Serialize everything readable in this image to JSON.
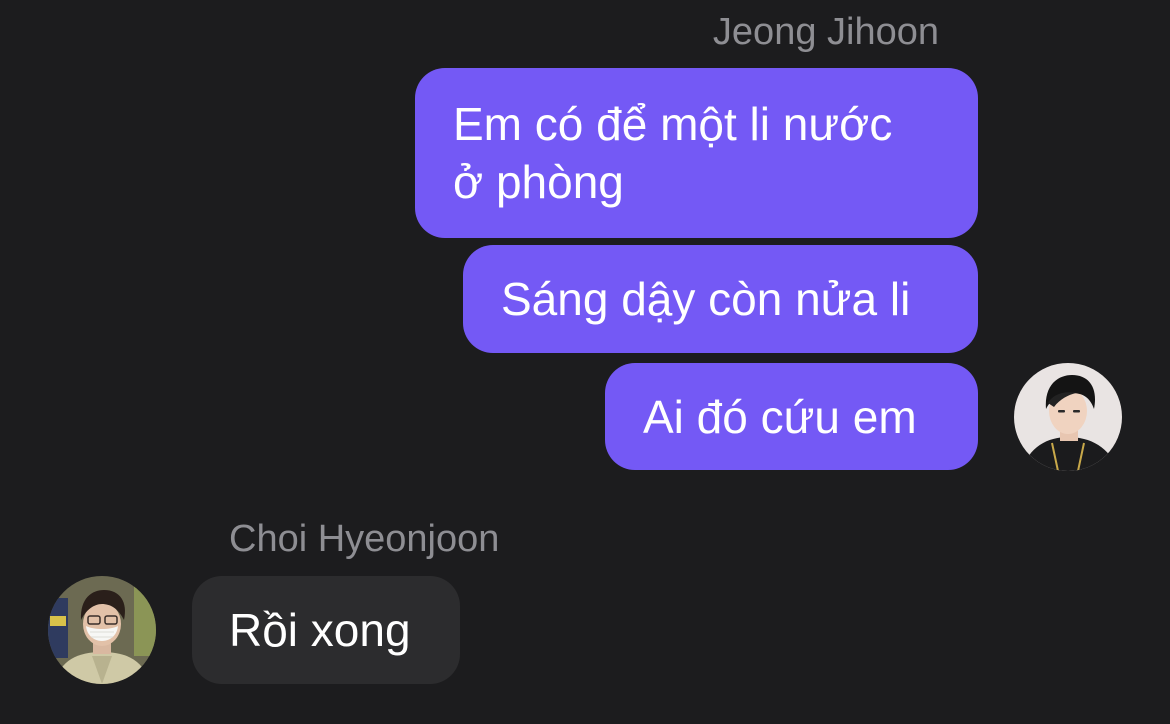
{
  "conversation": {
    "outgoing_group": {
      "sender_name": "Jeong Jihoon",
      "messages": [
        {
          "text": "Em có để một li nước\nở phòng"
        },
        {
          "text": "Sáng dậy còn nửa li"
        },
        {
          "text": "Ai đó cứu em"
        }
      ]
    },
    "incoming_group": {
      "sender_name": "Choi Hyeonjoon",
      "messages": [
        {
          "text": "Rồi xong"
        }
      ]
    }
  },
  "colors": {
    "background": "#1c1c1e",
    "outgoing_bubble": "#7459f5",
    "incoming_bubble": "#2c2c2e",
    "sender_name": "#8e8e93",
    "message_text": "#ffffff"
  }
}
